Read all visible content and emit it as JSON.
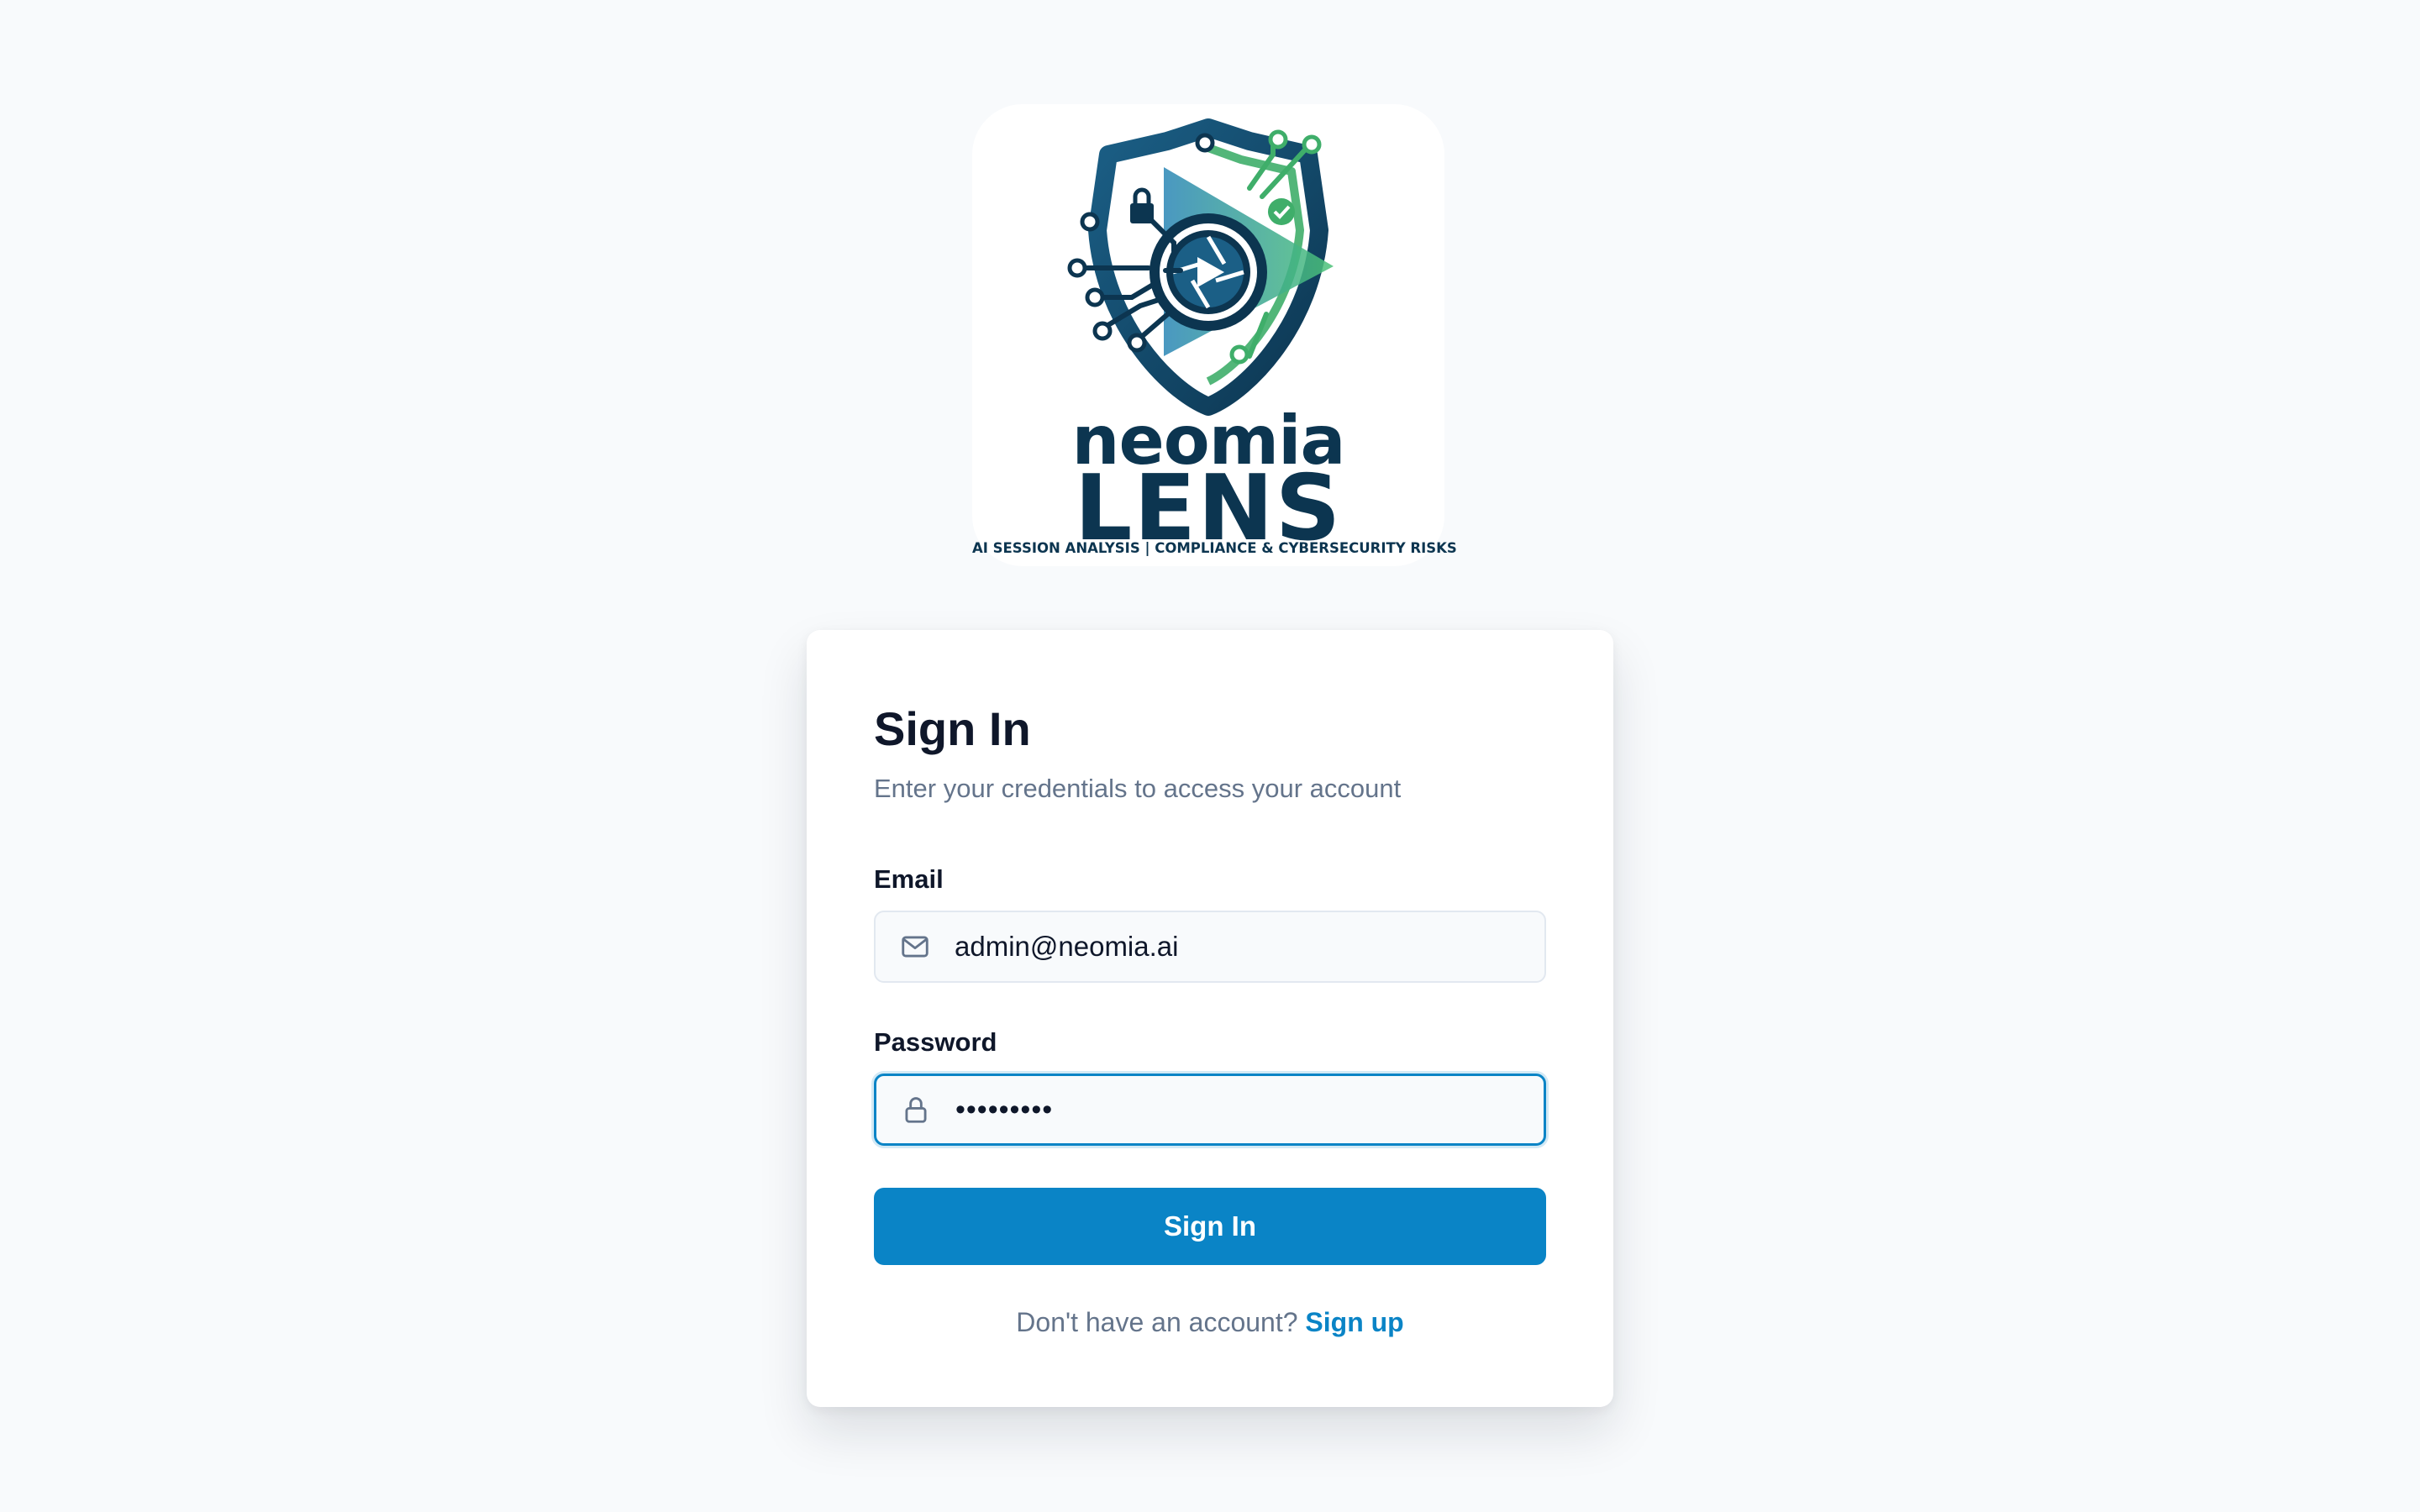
{
  "logo": {
    "word_top": "neomia",
    "word_main": "LENS",
    "tagline": "AI SESSION ANALYSIS | COMPLIANCE & CYBERSECURITY RISKS",
    "icon": "shield-lens-circuit-logo"
  },
  "card": {
    "title": "Sign In",
    "subtitle": "Enter your credentials to access your account"
  },
  "email": {
    "label": "Email",
    "value": "admin@neomia.ai",
    "icon": "mail-icon"
  },
  "password": {
    "label": "Password",
    "value": "•••••••••",
    "icon": "lock-icon"
  },
  "submit": {
    "label": "Sign In"
  },
  "signup": {
    "prompt": "Don't have an account?",
    "link": "Sign up"
  },
  "colors": {
    "background": "#f8fafc",
    "accent": "#0a84c6",
    "text": "#0f172a",
    "muted": "#64748b",
    "logo_dark": "#0c3550",
    "logo_green": "#3fae6a"
  }
}
